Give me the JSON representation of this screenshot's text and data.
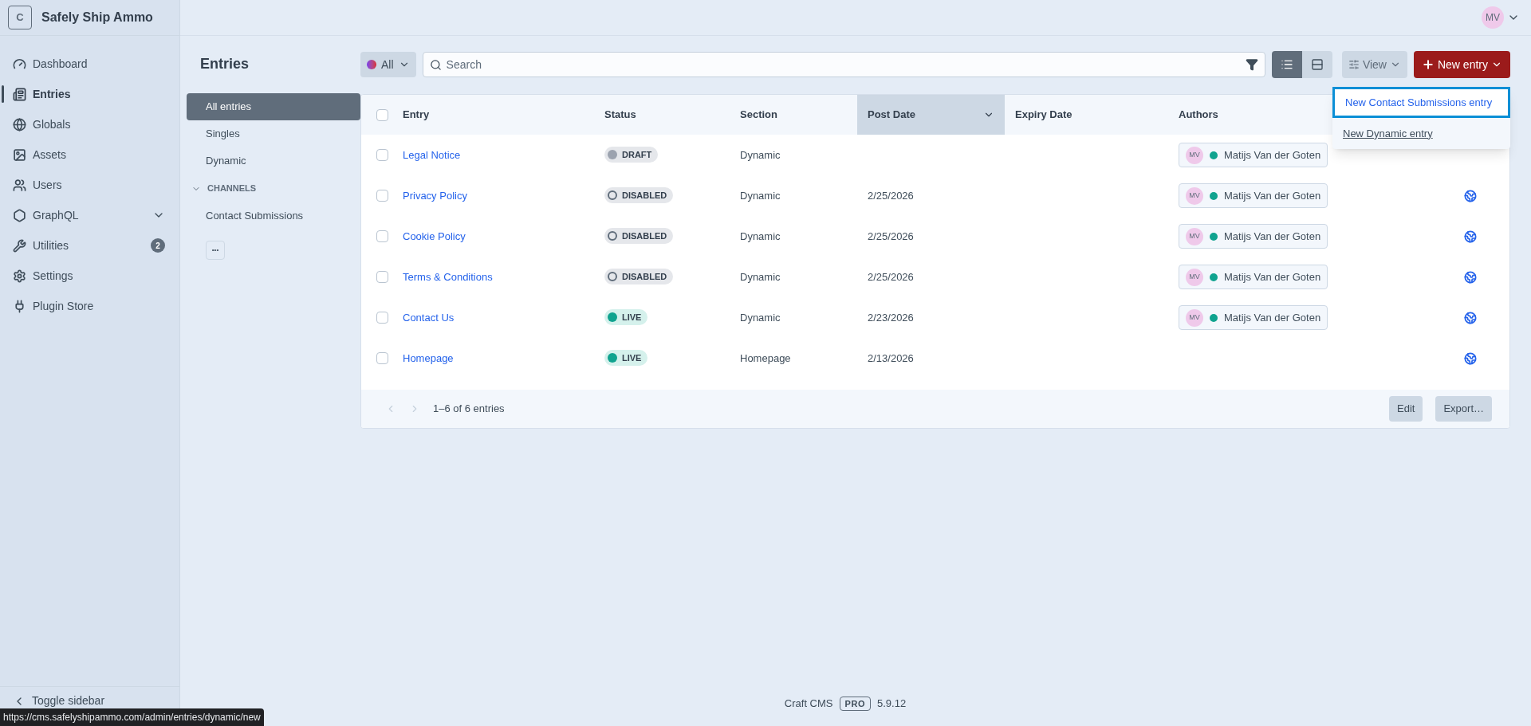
{
  "site": {
    "logo_letter": "C",
    "name": "Safely Ship Ammo"
  },
  "user": {
    "initials": "MV"
  },
  "nav": [
    {
      "kind": "dashboard",
      "label": "Dashboard",
      "selected": false
    },
    {
      "kind": "entries",
      "label": "Entries",
      "selected": true
    },
    {
      "kind": "globals",
      "label": "Globals",
      "selected": false
    },
    {
      "kind": "assets",
      "label": "Assets",
      "selected": false
    },
    {
      "kind": "users",
      "label": "Users",
      "selected": false
    },
    {
      "kind": "graphql",
      "label": "GraphQL",
      "selected": false,
      "expandable": true
    },
    {
      "kind": "utilities",
      "label": "Utilities",
      "selected": false,
      "badge": "2"
    },
    {
      "kind": "settings",
      "label": "Settings",
      "selected": false
    },
    {
      "kind": "plugins",
      "label": "Plugin Store",
      "selected": false
    }
  ],
  "toggle_sidebar": "Toggle sidebar",
  "page_title": "Entries",
  "sources": [
    {
      "kind": "item",
      "label": "All entries",
      "selected": true
    },
    {
      "kind": "item",
      "label": "Singles",
      "selected": false
    },
    {
      "kind": "item",
      "label": "Dynamic",
      "selected": false
    },
    {
      "kind": "heading",
      "label": "CHANNELS",
      "expanded": true
    },
    {
      "kind": "item",
      "label": "Contact Submissions",
      "selected": false
    }
  ],
  "more_button": "•••",
  "toolbar": {
    "site_menu": "All",
    "search": {
      "placeholder": "Search"
    },
    "view_modes": [
      {
        "kind": "table",
        "selected": true
      },
      {
        "kind": "structure",
        "selected": false
      }
    ],
    "view_button": "View",
    "new_button": "New entry"
  },
  "new_menu": [
    {
      "label": "New Contact Submissions entry",
      "focused": true
    },
    {
      "label": "New Dynamic entry",
      "focused": false
    }
  ],
  "table": {
    "select_all_checked": false,
    "columns": [
      {
        "label": "Entry",
        "sorted": false
      },
      {
        "label": "Status",
        "sorted": false
      },
      {
        "label": "Section",
        "sorted": false
      },
      {
        "label": "Post Date",
        "sorted": true
      },
      {
        "label": "Expiry Date",
        "sorted": false
      },
      {
        "label": "Authors",
        "sorted": false
      }
    ],
    "rows": [
      {
        "checked": false,
        "title": "Legal Notice",
        "status": {
          "kind": "draft",
          "label": "DRAFT"
        },
        "section": "Dynamic",
        "post_date": "",
        "author": {
          "initials": "MV",
          "name": "Matijs Van der Goten"
        },
        "link": false
      },
      {
        "checked": false,
        "title": "Privacy Policy",
        "status": {
          "kind": "disabled",
          "label": "DISABLED"
        },
        "section": "Dynamic",
        "post_date": "2/25/2026",
        "author": {
          "initials": "MV",
          "name": "Matijs Van der Goten"
        },
        "link": true
      },
      {
        "checked": false,
        "title": "Cookie Policy",
        "status": {
          "kind": "disabled",
          "label": "DISABLED"
        },
        "section": "Dynamic",
        "post_date": "2/25/2026",
        "author": {
          "initials": "MV",
          "name": "Matijs Van der Goten"
        },
        "link": true
      },
      {
        "checked": false,
        "title": "Terms & Conditions",
        "status": {
          "kind": "disabled",
          "label": "DISABLED"
        },
        "section": "Dynamic",
        "post_date": "2/25/2026",
        "author": {
          "initials": "MV",
          "name": "Matijs Van der Goten"
        },
        "link": true
      },
      {
        "checked": false,
        "title": "Contact Us",
        "status": {
          "kind": "live",
          "label": "LIVE"
        },
        "section": "Dynamic",
        "post_date": "2/23/2026",
        "author": {
          "initials": "MV",
          "name": "Matijs Van der Goten"
        },
        "link": true
      },
      {
        "checked": false,
        "title": "Homepage",
        "status": {
          "kind": "live",
          "label": "LIVE"
        },
        "section": "Homepage",
        "post_date": "2/13/2026",
        "link": true
      }
    ],
    "count": "1–6 of 6 entries",
    "actions": [
      "Edit",
      "Export…"
    ]
  },
  "footer": {
    "product": "Craft CMS",
    "edition": "PRO",
    "version": "5.9.12"
  },
  "status_url": "https://cms.safelyshipammo.com/admin/entries/dynamic/new"
}
